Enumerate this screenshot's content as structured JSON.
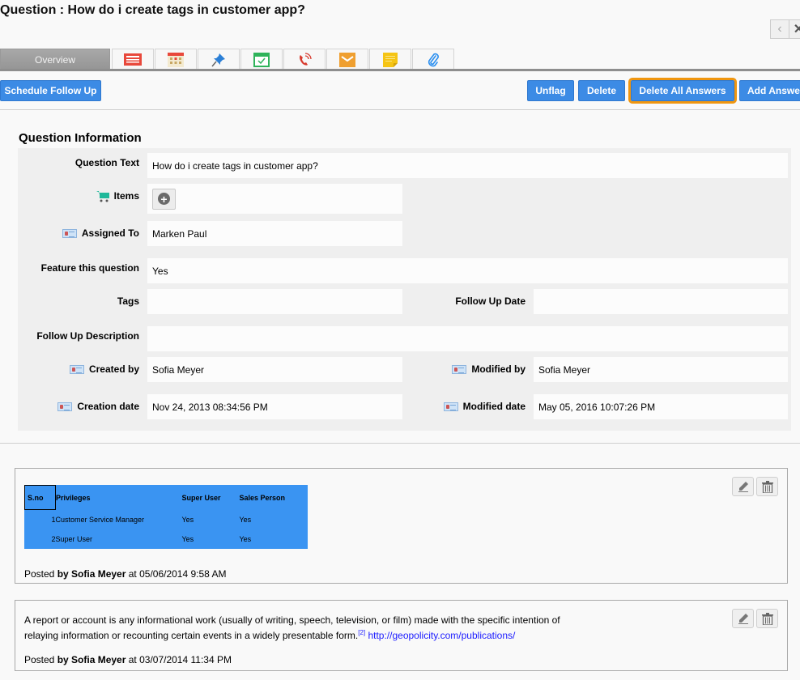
{
  "header": {
    "title": "Question : How do i create tags in customer app?",
    "prev_icon": "chevron-left-icon",
    "next_icon": "close-icon",
    "prev_glyph": "‹",
    "next_glyph": "✕"
  },
  "tabs": [
    {
      "label": "Overview",
      "icon": null
    },
    {
      "label": "",
      "icon": "notes-icon"
    },
    {
      "label": "",
      "icon": "calendar-icon"
    },
    {
      "label": "",
      "icon": "pin-icon"
    },
    {
      "label": "",
      "icon": "task-icon"
    },
    {
      "label": "",
      "icon": "call-icon"
    },
    {
      "label": "",
      "icon": "mail-icon"
    },
    {
      "label": "",
      "icon": "sticky-note-icon"
    },
    {
      "label": "",
      "icon": "attachment-icon"
    }
  ],
  "toolbar": {
    "schedule_follow_up": "Schedule Follow Up",
    "unflag": "Unflag",
    "delete": "Delete",
    "delete_all_answers": "Delete All Answers",
    "add_answer": "Add Answer"
  },
  "question_info": {
    "section_title": "Question Information",
    "fields": {
      "question_text": {
        "label": "Question Text",
        "value": "How do i create tags in customer app?"
      },
      "items": {
        "label": "Items",
        "value": ""
      },
      "assigned_to": {
        "label": "Assigned To",
        "value": "Marken Paul"
      },
      "feature": {
        "label": "Feature this question",
        "value": "Yes"
      },
      "tags": {
        "label": "Tags",
        "value": ""
      },
      "follow_up_date": {
        "label": "Follow Up Date",
        "value": ""
      },
      "follow_up_description": {
        "label": "Follow Up Description",
        "value": ""
      },
      "created_by": {
        "label": "Created by",
        "value": "Sofia Meyer"
      },
      "modified_by": {
        "label": "Modified by",
        "value": "Sofia Meyer"
      },
      "creation_date": {
        "label": "Creation date",
        "value": "Nov 24, 2013 08:34:56 PM"
      },
      "modified_date": {
        "label": "Modified date",
        "value": "May 05, 2016 10:07:26 PM"
      }
    }
  },
  "answers": [
    {
      "table": {
        "headers": [
          "S.no",
          "Privileges",
          "Super User",
          "Sales Person"
        ],
        "rows": [
          [
            "1",
            "Customer Service Manager",
            "Yes",
            "Yes"
          ],
          [
            "2",
            "Super User",
            "Yes",
            "Yes"
          ]
        ]
      },
      "posted_prefix": "Posted",
      "posted_by": "by Sofia Meyer",
      "posted_at": "at 05/06/2014 9:58 AM"
    },
    {
      "text": "A report or account is any informational work (usually of writing, speech, television, or film) made with the specific intention of relaying information or recounting certain events in a widely presentable form.",
      "footnote": "[2]",
      "link": "http://geopolicity.com/publications/",
      "posted_prefix": "Posted",
      "posted_by": "by Sofia Meyer",
      "posted_at": "at 03/07/2014 11:34 PM"
    }
  ],
  "colors": {
    "accent_button": "#3c8be5",
    "highlight_outline": "#f0960f",
    "table_bg": "#3a94f2"
  }
}
